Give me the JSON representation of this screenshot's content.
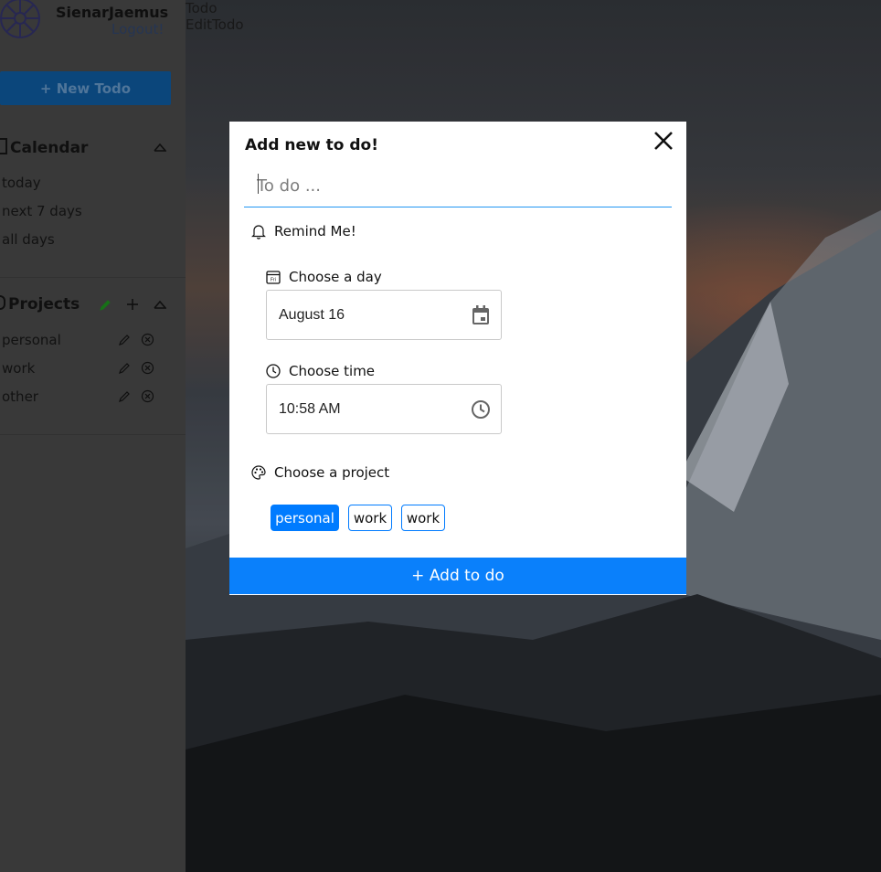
{
  "user": {
    "name": "SienarJaemus",
    "logout_label": "Logout!"
  },
  "sidebar": {
    "new_todo_label": "+ New Todo",
    "calendar": {
      "title": "Calendar",
      "items": [
        "today",
        "next 7 days",
        "all days"
      ]
    },
    "projects": {
      "title": "Projects",
      "items": [
        "personal",
        "work",
        "other"
      ]
    }
  },
  "nav": {
    "links": [
      "Todo",
      "EditTodo"
    ]
  },
  "modal": {
    "title": "Add new to do!",
    "todo_placeholder": "To do ...",
    "todo_value": "",
    "remind_label": "Remind Me!",
    "day_label": "Choose a day",
    "day_value": "August 16",
    "time_label": "Choose time",
    "time_value": "10:58 AM",
    "project_label": "Choose a project",
    "projects": [
      "personal",
      "work",
      "work"
    ],
    "selected_project": "personal",
    "add_label": "+ Add to do"
  },
  "colors": {
    "accent": "#007bff",
    "sidebar_bg": "#3e3e3e",
    "pencil_green": "#1a7a1a"
  },
  "icons": {
    "avatar": "wheel-avatar-icon",
    "close": "close-icon",
    "bell": "bell-icon",
    "calendar_day": "calendar-day-icon",
    "clock": "clock-icon",
    "palette": "palette-icon",
    "calendar_picker": "calendar-picker-icon",
    "pencil": "pencil-icon",
    "remove": "remove-circle-icon",
    "plus": "plus-icon",
    "chevron": "chevron-up-icon"
  }
}
